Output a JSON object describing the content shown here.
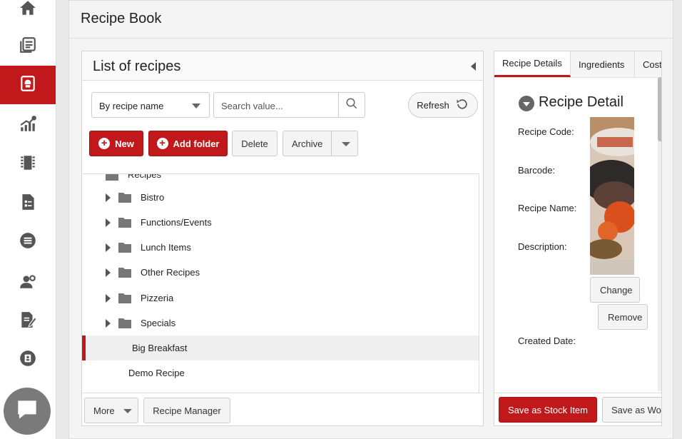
{
  "page": {
    "title": "Recipe Book"
  },
  "sidebar": {
    "items": [
      {
        "icon": "home-icon",
        "active": false
      },
      {
        "icon": "book-list-icon",
        "active": false
      },
      {
        "icon": "recipe-book-icon",
        "active": true
      },
      {
        "icon": "chart-dollar-icon",
        "active": false
      },
      {
        "icon": "film-strip-icon",
        "active": false
      },
      {
        "icon": "document-form-icon",
        "active": false
      },
      {
        "icon": "list-circle-icon",
        "active": false
      },
      {
        "icon": "user-gear-icon",
        "active": false
      },
      {
        "icon": "edit-document-icon",
        "active": false
      },
      {
        "icon": "contact-icon",
        "active": false
      }
    ],
    "chat_icon": "chat-bubble-icon"
  },
  "list_panel": {
    "title": "List of recipes",
    "filter_selected": "By recipe name",
    "search_placeholder": "Search value...",
    "refresh_label": "Refresh",
    "new_label": "New",
    "add_folder_label": "Add folder",
    "delete_label": "Delete",
    "archive_label": "Archive",
    "tree_root": "Recipes",
    "folders": [
      "Bistro",
      "Functions/Events",
      "Lunch Items",
      "Other Recipes",
      "Pizzeria",
      "Specials"
    ],
    "recipes": [
      "Big Breakfast",
      "Demo Recipe"
    ],
    "selected_recipe": "Big Breakfast",
    "more_label": "More",
    "recipe_manager_label": "Recipe Manager"
  },
  "detail_panel": {
    "tabs": [
      "Recipe Details",
      "Ingredients",
      "Cost"
    ],
    "active_tab": "Recipe Details",
    "title": "Recipe Detail",
    "fields": [
      "Recipe Code:",
      "Barcode:",
      "Recipe Name:",
      "Description:",
      "Created Date:"
    ],
    "change_label": "Change",
    "remove_label": "Remove",
    "save_stock_label": "Save as Stock Item",
    "save_work_label": "Save as Work"
  },
  "colors": {
    "accent": "#c0181b",
    "background": "#e9e9e9"
  }
}
